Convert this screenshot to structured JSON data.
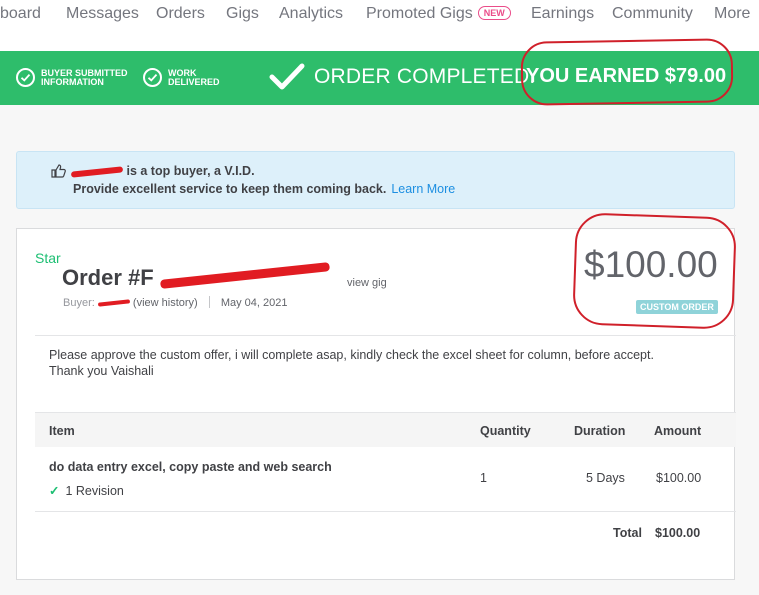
{
  "nav": {
    "items": [
      "board",
      "Messages",
      "Orders",
      "Gigs",
      "Analytics",
      "Promoted Gigs",
      "Earnings",
      "Community",
      "More"
    ],
    "new_badge": "NEW"
  },
  "status_bar": {
    "steps": [
      "BUYER SUBMITTED INFORMATION",
      "WORK DELIVERED"
    ],
    "completed_text": "ORDER COMPLETED.",
    "earned_text": "YOU EARNED $79.00"
  },
  "banner": {
    "line1": "is a top buyer, a V.I.D.",
    "line2": "Provide excellent service to keep them coming back.",
    "learn_more": "Learn More"
  },
  "order": {
    "star_label": "Star",
    "title": "Order #F",
    "view_gig": "view gig",
    "buyer_label": "Buyer:",
    "view_history": "(view history)",
    "date": "May 04, 2021",
    "price": "$100.00",
    "badge": "CUSTOM ORDER",
    "message": "Please approve the custom offer, i will complete asap, kindly check the excel sheet for column, before accept. Thank you Vaishali"
  },
  "table": {
    "headers": {
      "item": "Item",
      "quantity": "Quantity",
      "duration": "Duration",
      "amount": "Amount"
    },
    "row": {
      "item": "do data entry excel, copy paste and web search",
      "revision": "1 Revision",
      "quantity": "1",
      "duration": "5 Days",
      "amount": "$100.00"
    },
    "total_label": "Total",
    "total_value": "$100.00"
  },
  "colors": {
    "green": "#2ebd6b",
    "accent_link": "#1d8fe1",
    "annotation_red": "#d0202a"
  }
}
